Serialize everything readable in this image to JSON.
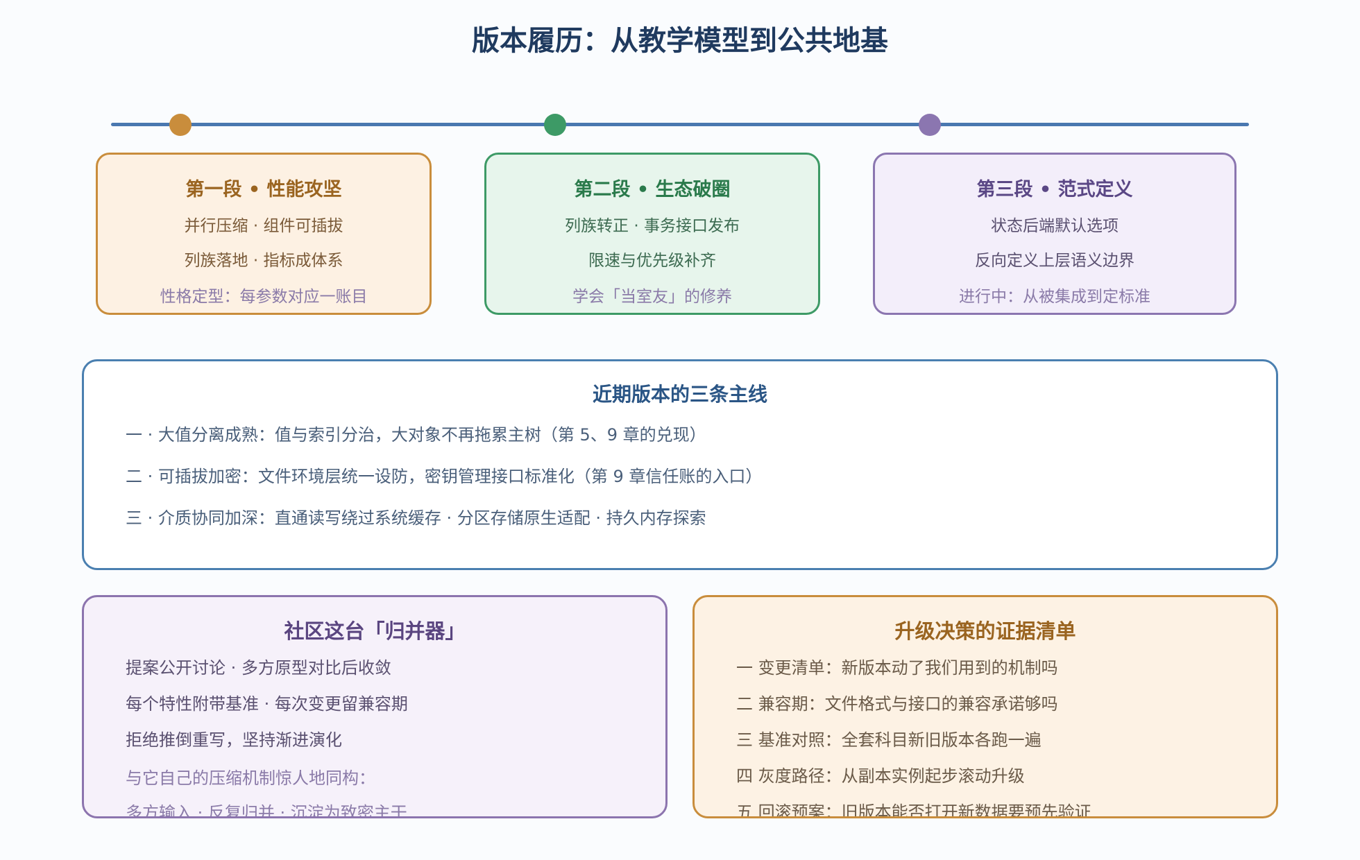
{
  "title": "版本履历：从教学模型到公共地基",
  "timeline": {
    "dot_colors": [
      "#c98d3c",
      "#3d9a66",
      "#8b76b0"
    ]
  },
  "phases": [
    {
      "title": "第一段 • 性能攻坚",
      "line1": "并行压缩 · 组件可插拔",
      "line2": "列族落地 · 指标成体系",
      "note": "性格定型：每参数对应一账目"
    },
    {
      "title": "第二段 • 生态破圈",
      "line1": "列族转正 · 事务接口发布",
      "line2": "限速与优先级补齐",
      "note": "学会「当室友」的修养"
    },
    {
      "title": "第三段 • 范式定义",
      "line1": "状态后端默认选项",
      "line2": "反向定义上层语义边界",
      "note": "进行中：从被集成到定标准"
    }
  ],
  "mainlines": {
    "title": "近期版本的三条主线",
    "items": [
      "一 · 大值分离成熟：值与索引分治，大对象不再拖累主树（第 5、9 章的兑现）",
      "二 · 可插拔加密：文件环境层统一设防，密钥管理接口标准化（第 9 章信任账的入口）",
      "三 · 介质协同加深：直通读写绕过系统缓存 · 分区存储原生适配 · 持久内存探索"
    ]
  },
  "community": {
    "title": "社区这台「归并器」",
    "items": [
      "提案公开讨论 · 多方原型对比后收敛",
      "每个特性附带基准 · 每次变更留兼容期",
      "拒绝推倒重写，坚持渐进演化"
    ],
    "note1": "与它自己的压缩机制惊人地同构：",
    "note2": "多方输入 · 反复归并 · 沉淀为致密主干"
  },
  "upgrade": {
    "title": "升级决策的证据清单",
    "items": [
      "一 变更清单：新版本动了我们用到的机制吗",
      "二 兼容期：文件格式与接口的兼容承诺够吗",
      "三 基准对照：全套科目新旧版本各跑一遍",
      "四 灰度路径：从副本实例起步滚动升级",
      "五 回滚预案：旧版本能否打开新数据要预先验证"
    ]
  }
}
